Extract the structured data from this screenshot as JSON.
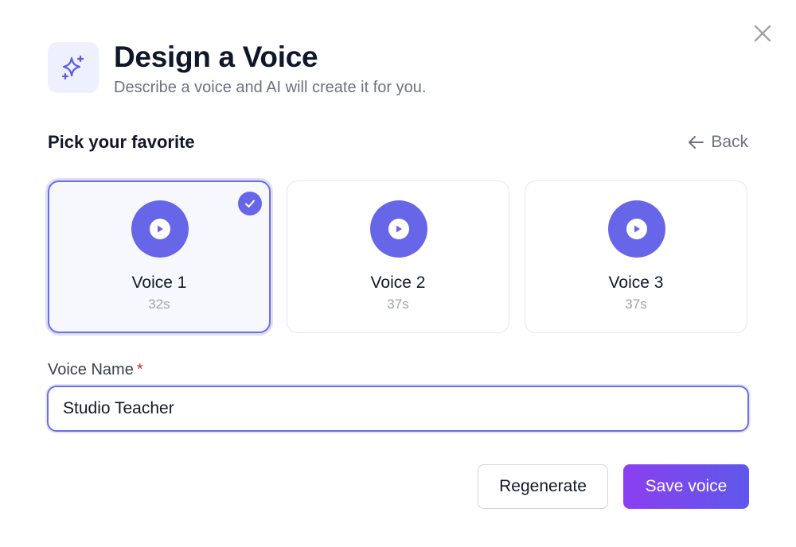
{
  "dialog": {
    "title": "Design a Voice",
    "subtitle": "Describe a voice and AI will create it for you.",
    "header_icon": "sparkles-icon",
    "close_icon": "close-icon"
  },
  "picker": {
    "label": "Pick your favorite",
    "back_label": "Back",
    "back_icon": "arrow-left-icon",
    "voices": [
      {
        "name": "Voice 1",
        "duration": "32s",
        "selected": true
      },
      {
        "name": "Voice 2",
        "duration": "37s",
        "selected": false
      },
      {
        "name": "Voice 3",
        "duration": "37s",
        "selected": false
      }
    ]
  },
  "form": {
    "name_label": "Voice Name",
    "required_mark": "*",
    "name_value": "Studio Teacher"
  },
  "actions": {
    "regenerate_label": "Regenerate",
    "save_label": "Save voice"
  },
  "colors": {
    "accent": "#6766e8",
    "required": "#dc2626",
    "primary_gradient_start": "#8b3ff0",
    "primary_gradient_end": "#5f58ea"
  }
}
